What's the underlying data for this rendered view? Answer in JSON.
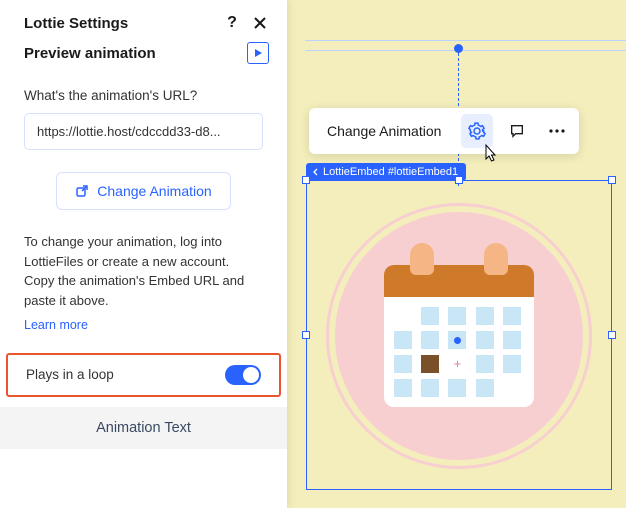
{
  "panel": {
    "title": "Lottie Settings",
    "preview_label": "Preview animation",
    "url_label": "What's the animation's URL?",
    "url_value": "https://lottie.host/cdccdd33-d8...",
    "change_btn": "Change Animation",
    "help_text": "To change your animation, log into LottieFiles or create a new account. Copy the animation's Embed URL and paste it above.",
    "learn_more": "Learn more",
    "loop_label": "Plays in a loop",
    "footer_tab": "Animation Text"
  },
  "toolbar": {
    "change_label": "Change Animation"
  },
  "badge": {
    "label": "LottieEmbed #lottieEmbed1"
  }
}
